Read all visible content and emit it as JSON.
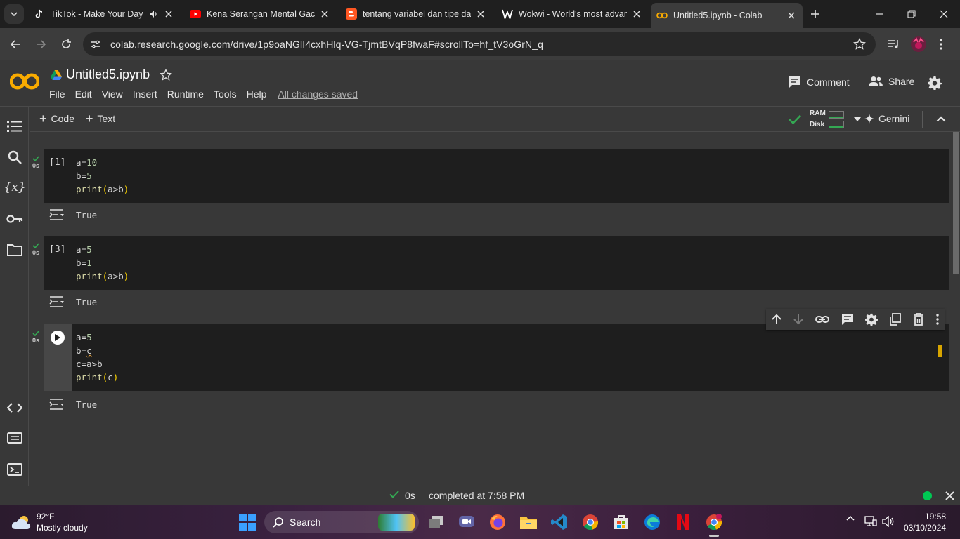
{
  "browser": {
    "tabs": [
      {
        "title": "TikTok - Make Your Day",
        "icon": "tiktok-icon"
      },
      {
        "title": "Kena Serangan Mental Gacha",
        "icon": "youtube-icon"
      },
      {
        "title": "tentang variabel dan tipe da",
        "icon": "blogger-icon"
      },
      {
        "title": "Wokwi - World's most advan",
        "icon": "wokwi-icon"
      },
      {
        "title": "Untitled5.ipynb - Colab",
        "icon": "colab-icon",
        "active": true
      }
    ],
    "url": "colab.research.google.com/drive/1p9oaNGlI4cxhHlq-VG-TjmtBVqP8fwaF#scrollTo=hf_tV3oGrN_q"
  },
  "colab": {
    "notebook_title": "Untitled5.ipynb",
    "menu": [
      "File",
      "Edit",
      "View",
      "Insert",
      "Runtime",
      "Tools",
      "Help"
    ],
    "save_status": "All changes saved",
    "comment_label": "Comment",
    "share_label": "Share",
    "add_code_label": "Code",
    "add_text_label": "Text",
    "ram_label": "RAM",
    "disk_label": "Disk",
    "gemini_label": "Gemini"
  },
  "cells": [
    {
      "exec_count": "[1]",
      "duration": "0s",
      "output": "True"
    },
    {
      "exec_count": "[3]",
      "duration": "0s",
      "output": "True"
    },
    {
      "exec_count": "",
      "duration": "0s",
      "output": "True"
    }
  ],
  "status": {
    "duration": "0s",
    "completed": "completed at 7:58 PM"
  },
  "taskbar": {
    "temperature": "92°F",
    "weather": "Mostly cloudy",
    "search_label": "Search",
    "time": "19:58",
    "date": "03/10/2024"
  },
  "colors": {
    "colab_orange": "#f9ab00",
    "success_green": "#34a853",
    "code_bg": "#1e1e1e",
    "page_bg": "#383838"
  }
}
